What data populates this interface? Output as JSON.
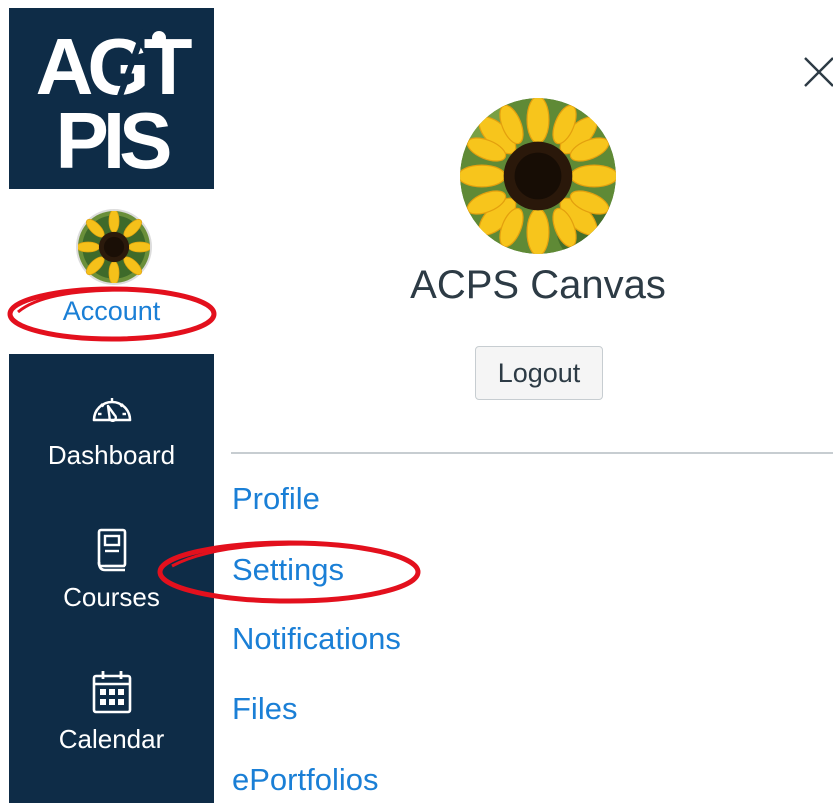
{
  "logo": {
    "line1": "AGT",
    "line2": "PIS"
  },
  "global_nav": {
    "account_label": "Account",
    "items": [
      {
        "label": "Dashboard",
        "icon": "speedometer-icon"
      },
      {
        "label": "Courses",
        "icon": "book-icon"
      },
      {
        "label": "Calendar",
        "icon": "calendar-icon"
      }
    ]
  },
  "account_tray": {
    "user_name": "ACPS Canvas",
    "logout_label": "Logout",
    "links": [
      {
        "label": "Profile"
      },
      {
        "label": "Settings"
      },
      {
        "label": "Notifications"
      },
      {
        "label": "Files"
      },
      {
        "label": "ePortfolios"
      }
    ]
  },
  "colors": {
    "nav_background": "#0e2c47",
    "link_blue": "#1a7fd6",
    "text_dark": "#2d3b45",
    "annotation_red": "#e3101d"
  }
}
